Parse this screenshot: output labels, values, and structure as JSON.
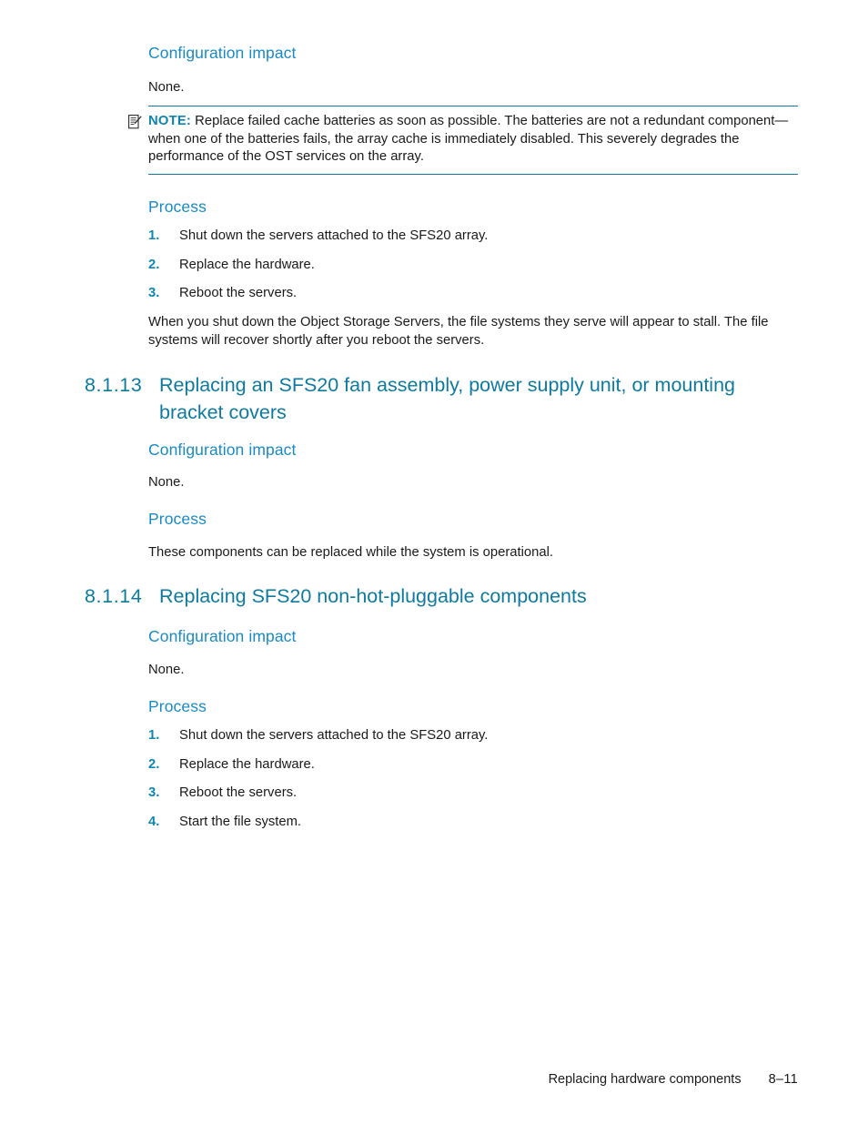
{
  "document": {
    "page_label": "8–11",
    "footer_title": "Replacing hardware components"
  },
  "colors": {
    "heading_blue": "#1a8ac4",
    "section_blue": "#0e7aa0",
    "rule_teal": "#0c7c9c",
    "step_number": "#0f86b6",
    "body_text": "#1a1a1a"
  },
  "sections": [
    {
      "id": "top",
      "config_impact_heading": "Configuration impact",
      "config_impact_text": "None.",
      "note": {
        "icon": "note-pencil-icon",
        "label": "NOTE:",
        "text": "Replace failed cache batteries as soon as possible. The batteries are not a redundant component—when one of the batteries fails, the array cache is immediately disabled. This severely degrades the performance of the OST services on the array."
      },
      "process_heading": "Process",
      "steps": [
        {
          "num": "1.",
          "text": "Shut down the servers attached to the SFS20 array."
        },
        {
          "num": "2.",
          "text": "Replace the hardware."
        },
        {
          "num": "3.",
          "text": "Reboot the servers."
        }
      ],
      "trailing_paragraph": "When you shut down the Object Storage Servers, the file systems they serve will appear to stall. The file systems will recover shortly after you reboot the servers."
    },
    {
      "id": "8-1-13",
      "number": "8.1.13",
      "title": "Replacing an SFS20 fan assembly, power supply unit, or mounting bracket covers",
      "config_impact_heading": "Configuration impact",
      "config_impact_text": "None.",
      "process_heading": "Process",
      "process_text": "These components can be replaced while the system is operational."
    },
    {
      "id": "8-1-14",
      "number": "8.1.14",
      "title": "Replacing SFS20 non-hot-pluggable components",
      "config_impact_heading": "Configuration impact",
      "config_impact_text": "None.",
      "process_heading": "Process",
      "steps": [
        {
          "num": "1.",
          "text": "Shut down the servers attached to the SFS20 array."
        },
        {
          "num": "2.",
          "text": "Replace the hardware."
        },
        {
          "num": "3.",
          "text": "Reboot the servers."
        },
        {
          "num": "4.",
          "text": "Start the file system."
        }
      ]
    }
  ]
}
